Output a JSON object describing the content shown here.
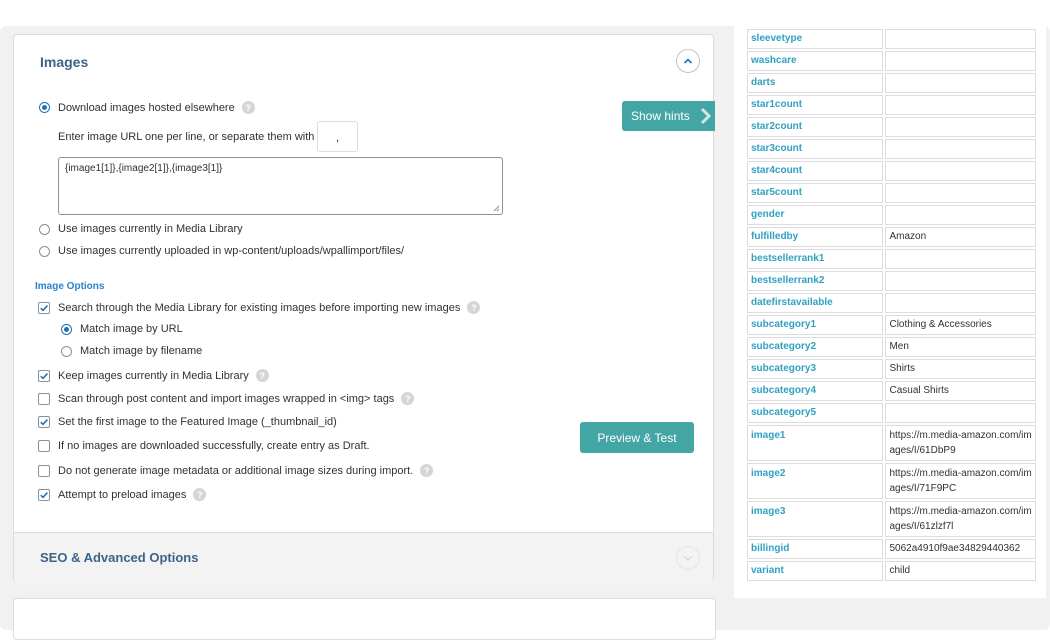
{
  "images_section": {
    "title": "Images",
    "download_label": "Download images hosted elsewhere",
    "enter_url_label": "Enter image URL one per line, or separate them with a",
    "separator_value": ",",
    "url_value": "{image1[1]},{image2[1]},{image3[1]}",
    "media_library_label": "Use images currently in Media Library",
    "uploaded_label": "Use images currently uploaded in wp-content/uploads/wpallimport/files/",
    "image_options_label": "Image Options",
    "options": {
      "search_media": "Search through the Media Library for existing images before importing new images",
      "match_url": "Match image by URL",
      "match_filename": "Match image by filename",
      "keep_images": "Keep images currently in Media Library",
      "scan_content": "Scan through post content and import images wrapped in <img> tags",
      "featured_image": "Set the first image to the Featured Image (_thumbnail_id)",
      "draft_if_none": "If no images are downloaded successfully, create entry as Draft.",
      "no_metadata": "Do not generate image metadata or additional image sizes during import.",
      "preload": "Attempt to preload images"
    },
    "show_hints_label": "Show hints",
    "preview_test_label": "Preview & Test",
    "help_glyph": "?"
  },
  "seo_section": {
    "title": "SEO & Advanced Options"
  },
  "fields_table": [
    {
      "key": "sleevetype",
      "value": ""
    },
    {
      "key": "washcare",
      "value": ""
    },
    {
      "key": "darts",
      "value": ""
    },
    {
      "key": "star1count",
      "value": ""
    },
    {
      "key": "star2count",
      "value": ""
    },
    {
      "key": "star3count",
      "value": ""
    },
    {
      "key": "star4count",
      "value": ""
    },
    {
      "key": "star5count",
      "value": ""
    },
    {
      "key": "gender",
      "value": ""
    },
    {
      "key": "fulfilledby",
      "value": "Amazon"
    },
    {
      "key": "bestsellerrank1",
      "value": ""
    },
    {
      "key": "bestsellerrank2",
      "value": ""
    },
    {
      "key": "datefirstavailable",
      "value": ""
    },
    {
      "key": "subcategory1",
      "value": "Clothing & Accessories"
    },
    {
      "key": "subcategory2",
      "value": "Men"
    },
    {
      "key": "subcategory3",
      "value": "Shirts"
    },
    {
      "key": "subcategory4",
      "value": "Casual Shirts"
    },
    {
      "key": "subcategory5",
      "value": ""
    },
    {
      "key": "image1",
      "value": "https://m.media-amazon.com/images/I/61DbP9"
    },
    {
      "key": "image2",
      "value": "https://m.media-amazon.com/images/I/71F9PC"
    },
    {
      "key": "image3",
      "value": "https://m.media-amazon.com/images/I/61zlzf7l"
    },
    {
      "key": "billingid",
      "value": "5062a4910f9ae34829440362"
    },
    {
      "key": "variant",
      "value": "child"
    }
  ],
  "colors": {
    "accent": "#44a6a4",
    "field_key": "#30a1c1",
    "section_title": "#40628a"
  }
}
